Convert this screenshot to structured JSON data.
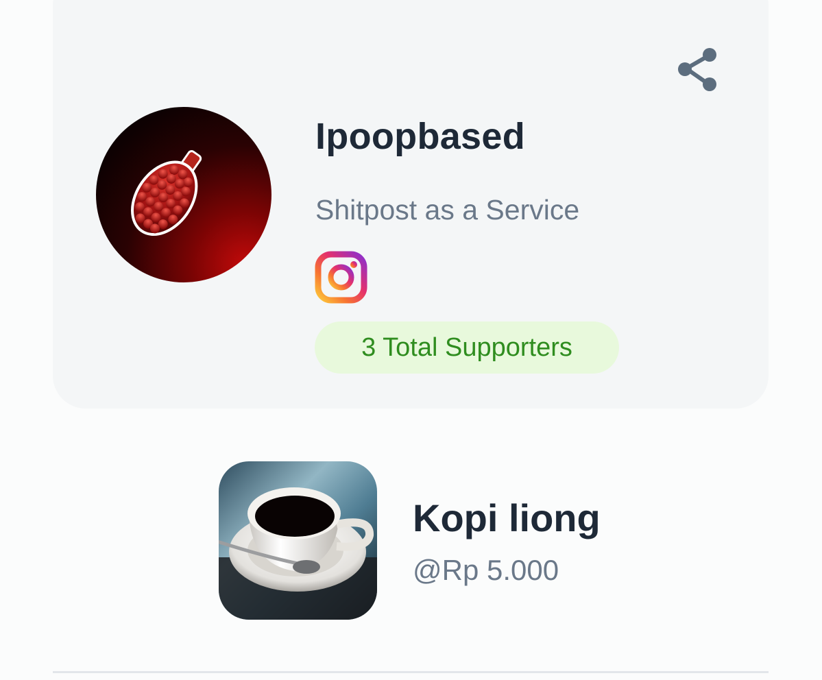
{
  "creator": {
    "name": "Ipoopbased",
    "tagline": "Shitpost as a Service",
    "avatar_icon": "red-seed-cone-avatar",
    "social_icon": "instagram-icon",
    "supporters_label": "3 Total Supporters"
  },
  "share": {
    "icon": "share-icon"
  },
  "product": {
    "name": "Kopi liong",
    "price": "@Rp 5.000",
    "image_icon": "coffee-cup-image"
  },
  "colors": {
    "title": "#1e2937",
    "muted": "#6a7889",
    "badge_bg": "#e8f9dc",
    "badge_text": "#2f8d1f",
    "card_bg": "#f4f6f7"
  }
}
